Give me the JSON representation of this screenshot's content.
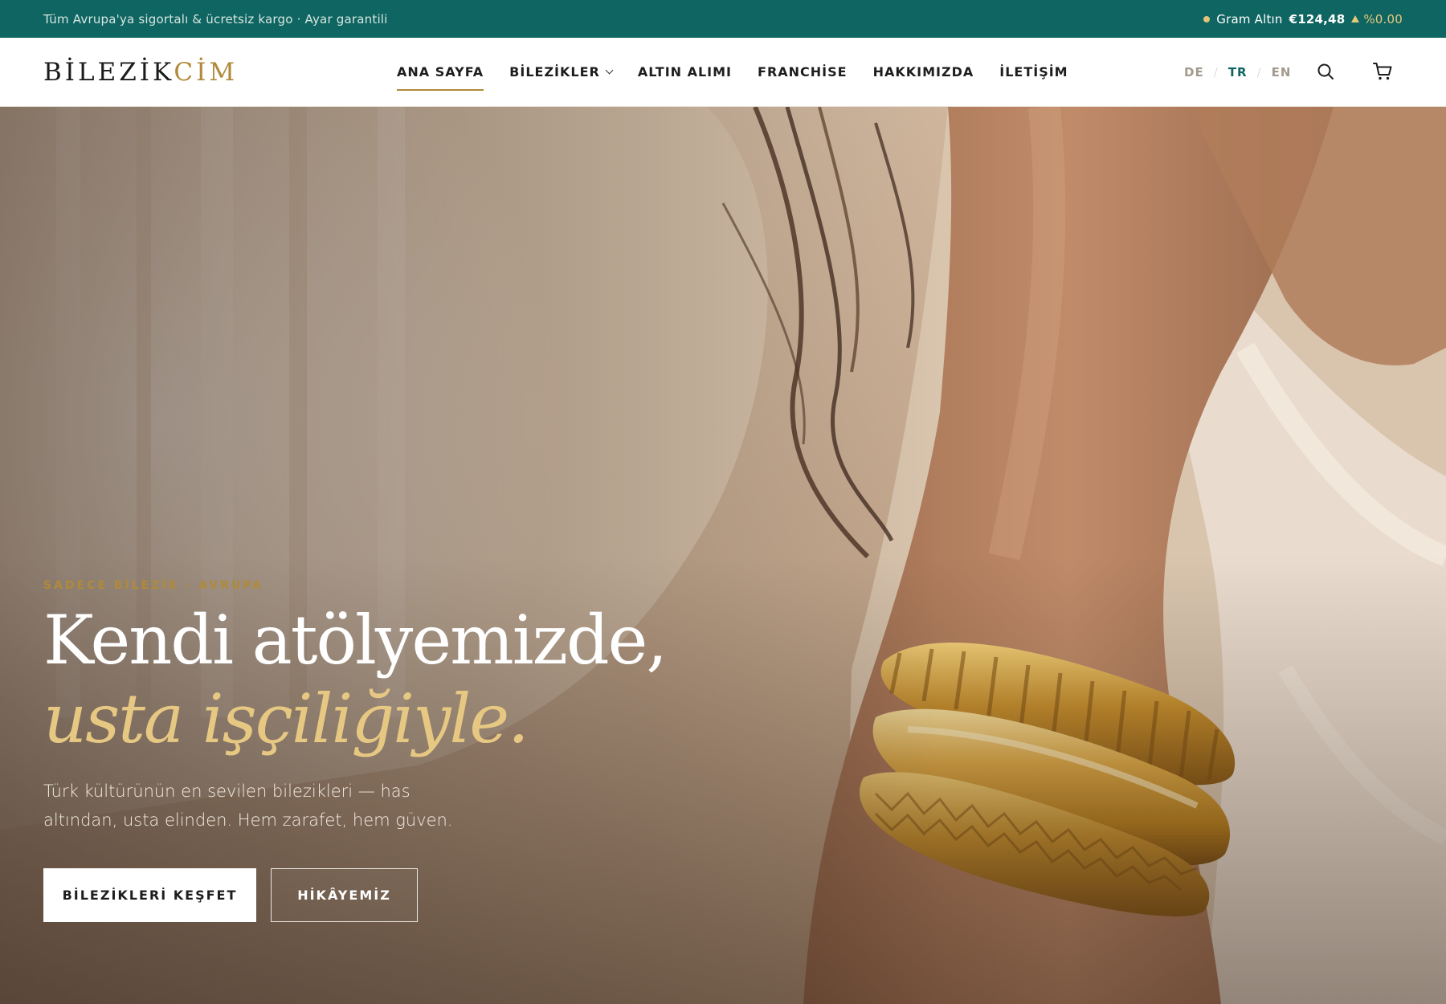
{
  "topbar": {
    "announcement": "Tüm Avrupa'ya sigortalı & ücretsiz kargo · Ayar garantili",
    "ticker": {
      "label": "Gram Altın",
      "price": "€124,48",
      "change": "%0.00"
    }
  },
  "header": {
    "logo": {
      "part1": "BİLEZİK",
      "part2": "CİM"
    },
    "nav": {
      "home": "ANA SAYFA",
      "bracelets": "BİLEZİKLER",
      "gold_buy": "ALTIN ALIMI",
      "franchise": "FRANCHİSE",
      "about": "HAKKIMIZDA",
      "contact": "İLETİŞİM"
    },
    "languages": {
      "de": "DE",
      "sep": "/",
      "tr": "TR",
      "en": "EN",
      "current": "TR"
    }
  },
  "hero": {
    "eyebrow": "SADECE BİLEZİK · AVRUPA",
    "headline_line1": "Kendi atölyemizde,",
    "headline_line2": "usta işçiliğiyle.",
    "subtext": "Türk kültürünün en sevilen bilezikleri — has altından, usta elinden. Hem zarafet, hem güven.",
    "primary_cta": "BİLEZİKLERİ KEŞFET",
    "secondary_cta": "HİKÂYEMİZ"
  },
  "colors": {
    "brand_teal": "#0e6561",
    "gold_accent": "#b08a3a",
    "headline_gold": "#e7c883"
  },
  "icons": [
    "search-icon",
    "cart-icon",
    "chevron-down-icon",
    "up-triangle-icon"
  ]
}
